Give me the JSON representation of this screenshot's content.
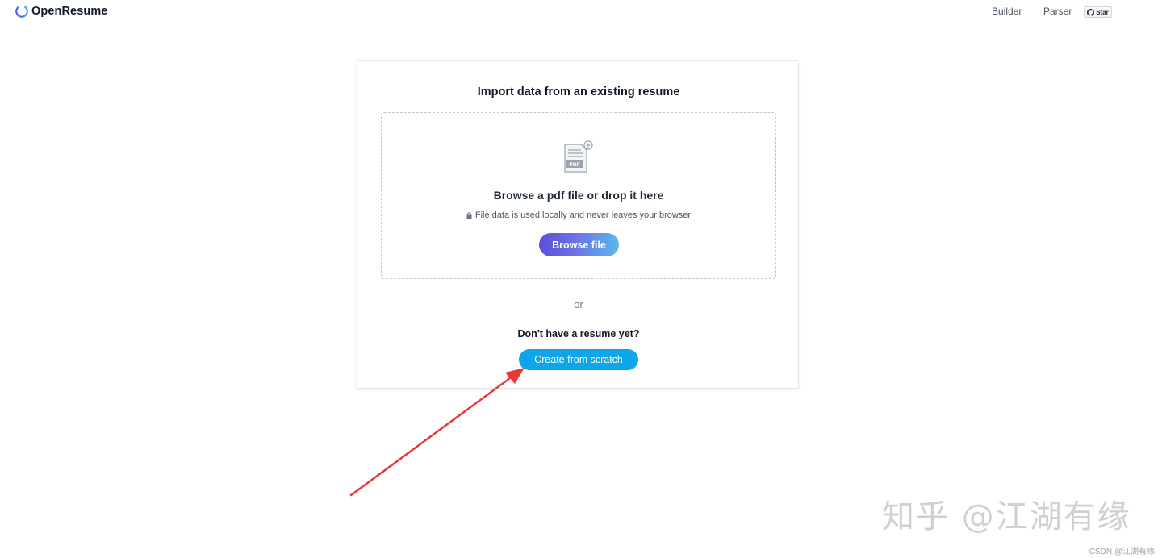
{
  "header": {
    "brand": "OpenResume",
    "nav": {
      "builder": "Builder",
      "parser": "Parser"
    },
    "github_star_label": "Star"
  },
  "card": {
    "import_title": "Import data from an existing resume",
    "dropzone": {
      "title": "Browse a pdf file or drop it here",
      "privacy_note": "File data is used locally and never leaves your browser",
      "browse_button": "Browse file",
      "file_icon_label": "PDF"
    },
    "or_label": "or",
    "no_resume_prompt": "Don't have a resume yet?",
    "create_button": "Create from scratch"
  },
  "annotation": {
    "arrow_color": "#e53935"
  },
  "watermarks": {
    "zhihu": "知乎 @江湖有缘",
    "csdn": "CSDN @江湖有缘"
  },
  "colors": {
    "create_button": "#0ea5e9",
    "browse_gradient_start": "#5b4fd8",
    "browse_gradient_end": "#58b9ea"
  }
}
